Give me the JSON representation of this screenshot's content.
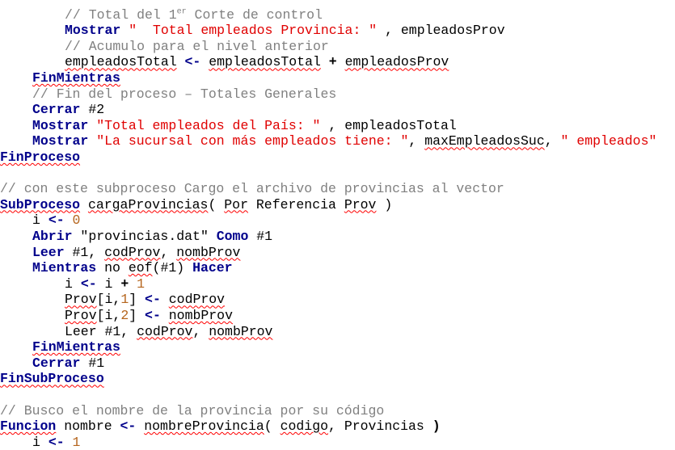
{
  "editor": {
    "lines": [
      [
        {
          "t": "// Total del 1",
          "c": "cm"
        },
        {
          "t": "er",
          "c": "cm",
          "sup": true
        },
        {
          "t": " Corte de control",
          "c": "cm"
        }
      ],
      [
        {
          "t": "Mostrar",
          "c": "kw"
        },
        {
          "t": " \"  Total empleados Provincia: \"",
          "c": "str"
        },
        {
          "t": " , ",
          "c": "id"
        },
        {
          "t": "empleadosProv",
          "c": "id"
        }
      ],
      [
        {
          "t": "// Acumulo para el nivel anterior",
          "c": "cm"
        }
      ],
      [
        {
          "t": "empleadosTotal",
          "c": "id",
          "sq": true
        },
        {
          "t": " ",
          "c": "id"
        },
        {
          "t": "<-",
          "c": "kw"
        },
        {
          "t": " ",
          "c": "id"
        },
        {
          "t": "empleadosTotal",
          "c": "id",
          "sq": true
        },
        {
          "t": " ",
          "c": "id"
        },
        {
          "t": "+",
          "c": "op",
          "b": true
        },
        {
          "t": " ",
          "c": "id"
        },
        {
          "t": "empleadosProv",
          "c": "id",
          "sq": true
        }
      ],
      [
        {
          "t": "FinMientras",
          "c": "kw",
          "sq": true
        }
      ],
      [
        {
          "t": "// Fin del proceso – Totales Generales",
          "c": "cm"
        }
      ],
      [
        {
          "t": "Cerrar",
          "c": "kw"
        },
        {
          "t": " #2",
          "c": "id"
        }
      ],
      [
        {
          "t": "Mostrar",
          "c": "kw"
        },
        {
          "t": " \"Total empleados del País: \"",
          "c": "str"
        },
        {
          "t": " , ",
          "c": "id"
        },
        {
          "t": "empleadosTotal",
          "c": "id"
        }
      ],
      [
        {
          "t": "Mostrar",
          "c": "kw"
        },
        {
          "t": " \"La sucursal con más empleados tiene: \"",
          "c": "str"
        },
        {
          "t": ", ",
          "c": "id"
        },
        {
          "t": "maxEmpleadosSuc",
          "c": "id",
          "sq": true
        },
        {
          "t": ", ",
          "c": "id"
        },
        {
          "t": "\" empleados\"",
          "c": "str"
        }
      ],
      [
        {
          "t": "FinProceso",
          "c": "kw",
          "sq": true
        }
      ],
      [],
      [
        {
          "t": "// con este subproceso Cargo el archivo de provincias al vector",
          "c": "cm"
        }
      ],
      [
        {
          "t": "SubProceso",
          "c": "kw",
          "sq": true
        },
        {
          "t": " ",
          "c": "id"
        },
        {
          "t": "cargaProvincias",
          "c": "id",
          "sq": true
        },
        {
          "t": "( ",
          "c": "id"
        },
        {
          "t": "Por",
          "c": "id",
          "sq": true
        },
        {
          "t": " Referencia ",
          "c": "id"
        },
        {
          "t": "Prov",
          "c": "id",
          "sq": true
        },
        {
          "t": " )",
          "c": "id"
        }
      ],
      [
        {
          "t": "i ",
          "c": "id"
        },
        {
          "t": "<-",
          "c": "kw"
        },
        {
          "t": " ",
          "c": "id"
        },
        {
          "t": "0",
          "c": "num"
        }
      ],
      [
        {
          "t": "Abrir",
          "c": "kw"
        },
        {
          "t": " \"provincias.dat\" ",
          "c": "id"
        },
        {
          "t": "Como",
          "c": "kw"
        },
        {
          "t": " #1",
          "c": "id"
        }
      ],
      [
        {
          "t": "Leer",
          "c": "kw"
        },
        {
          "t": " #1, ",
          "c": "id"
        },
        {
          "t": "codProv",
          "c": "id",
          "sq": true
        },
        {
          "t": ", ",
          "c": "id"
        },
        {
          "t": "nombProv",
          "c": "id",
          "sq": true
        }
      ],
      [
        {
          "t": "Mientras",
          "c": "kw"
        },
        {
          "t": " no ",
          "c": "id"
        },
        {
          "t": "eof",
          "c": "id",
          "sq": true
        },
        {
          "t": "(#1) ",
          "c": "id"
        },
        {
          "t": "Hacer",
          "c": "kw"
        }
      ],
      [
        {
          "t": "i ",
          "c": "id"
        },
        {
          "t": "<-",
          "c": "kw"
        },
        {
          "t": " i ",
          "c": "id"
        },
        {
          "t": "+",
          "c": "op",
          "b": true
        },
        {
          "t": " ",
          "c": "id"
        },
        {
          "t": "1",
          "c": "num"
        }
      ],
      [
        {
          "t": "Prov",
          "c": "id",
          "sq": true
        },
        {
          "t": "[i,",
          "c": "id"
        },
        {
          "t": "1",
          "c": "num"
        },
        {
          "t": "] ",
          "c": "id"
        },
        {
          "t": "<-",
          "c": "kw"
        },
        {
          "t": " ",
          "c": "id"
        },
        {
          "t": "codProv",
          "c": "id",
          "sq": true
        }
      ],
      [
        {
          "t": "Prov",
          "c": "id",
          "sq": true
        },
        {
          "t": "[i,",
          "c": "id"
        },
        {
          "t": "2",
          "c": "num"
        },
        {
          "t": "] ",
          "c": "id"
        },
        {
          "t": "<-",
          "c": "kw"
        },
        {
          "t": " ",
          "c": "id"
        },
        {
          "t": "nombProv",
          "c": "id",
          "sq": true
        }
      ],
      [
        {
          "t": "Leer #1, ",
          "c": "id"
        },
        {
          "t": "codProv",
          "c": "id",
          "sq": true
        },
        {
          "t": ", ",
          "c": "id"
        },
        {
          "t": "nombProv",
          "c": "id",
          "sq": true
        }
      ],
      [
        {
          "t": "FinMientras",
          "c": "kw",
          "sq": true
        }
      ],
      [
        {
          "t": "Cerrar",
          "c": "kw"
        },
        {
          "t": " #1",
          "c": "id"
        }
      ],
      [
        {
          "t": "FinSubProceso",
          "c": "kw",
          "sq": true
        }
      ],
      [],
      [
        {
          "t": "// Busco el nombre de la provincia por su código",
          "c": "cm"
        }
      ],
      [
        {
          "t": "Funcion",
          "c": "kw",
          "sq": true
        },
        {
          "t": " nombre ",
          "c": "id"
        },
        {
          "t": "<-",
          "c": "kw"
        },
        {
          "t": " ",
          "c": "id"
        },
        {
          "t": "nombreProvincia",
          "c": "id",
          "sq": true
        },
        {
          "t": "( ",
          "c": "id"
        },
        {
          "t": "codigo",
          "c": "id",
          "sq": true
        },
        {
          "t": ", Provincias ",
          "c": "id"
        },
        {
          "t": ")",
          "c": "id",
          "b": true
        }
      ],
      [
        {
          "t": "i ",
          "c": "id"
        },
        {
          "t": "<-",
          "c": "kw"
        },
        {
          "t": " ",
          "c": "id"
        },
        {
          "t": "1",
          "c": "num"
        }
      ]
    ]
  },
  "colors": {
    "keyword": "#00008b",
    "comment": "#808080",
    "string": "#e00000",
    "number": "#b5651d",
    "identifier": "#000000",
    "spellcheck_underline": "#ff0000",
    "background": "#ffffff"
  }
}
